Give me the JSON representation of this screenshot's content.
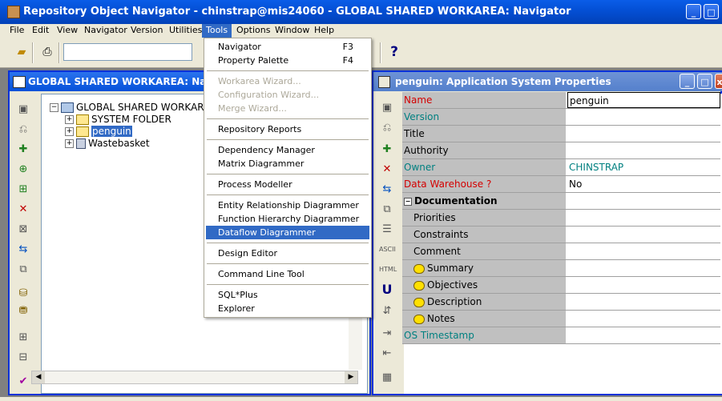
{
  "app": {
    "title": "Repository Object Navigator - chinstrap@mis24060 - GLOBAL SHARED WORKAREA: Navigator"
  },
  "menubar": [
    "File",
    "Edit",
    "View",
    "Navigator",
    "Version",
    "Utilities",
    "Tools",
    "Options",
    "Window",
    "Help"
  ],
  "active_menu": "Tools",
  "toolbar": {
    "help_icon": "?"
  },
  "navigator": {
    "title": "GLOBAL SHARED WORKAREA: Navig",
    "tree": [
      {
        "label": "GLOBAL SHARED WORKAR",
        "expander": "−"
      },
      {
        "label": "SYSTEM FOLDER",
        "expander": "+"
      },
      {
        "label": "penguin",
        "expander": "+"
      },
      {
        "label": "Wastebasket",
        "expander": "+"
      }
    ]
  },
  "tools_menu": {
    "items": [
      {
        "label": "Navigator",
        "shortcut": "F3",
        "state": "normal"
      },
      {
        "label": "Property Palette",
        "shortcut": "F4",
        "state": "normal"
      },
      {
        "label": "Workarea Wizard...",
        "shortcut": "",
        "state": "disabled"
      },
      {
        "label": "Configuration Wizard...",
        "shortcut": "",
        "state": "disabled"
      },
      {
        "label": "Merge Wizard...",
        "shortcut": "",
        "state": "disabled"
      },
      {
        "label": "Repository Reports",
        "shortcut": "",
        "state": "normal"
      },
      {
        "label": "Dependency Manager",
        "shortcut": "",
        "state": "normal"
      },
      {
        "label": "Matrix Diagrammer",
        "shortcut": "",
        "state": "normal"
      },
      {
        "label": "Process Modeller",
        "shortcut": "",
        "state": "normal"
      },
      {
        "label": "Entity Relationship Diagrammer",
        "shortcut": "",
        "state": "normal"
      },
      {
        "label": "Function Hierarchy Diagrammer",
        "shortcut": "",
        "state": "normal"
      },
      {
        "label": "Dataflow Diagrammer",
        "shortcut": "",
        "state": "selected"
      },
      {
        "label": "Design Editor",
        "shortcut": "",
        "state": "normal"
      },
      {
        "label": "Command Line Tool",
        "shortcut": "",
        "state": "normal"
      },
      {
        "label": "SQL*Plus",
        "shortcut": "",
        "state": "normal"
      },
      {
        "label": "Explorer",
        "shortcut": "",
        "state": "normal"
      }
    ]
  },
  "properties": {
    "title": "penguin: Application System Properties",
    "rows": [
      {
        "name": "Name",
        "value": "penguin",
        "name_color": "#d40000",
        "value_color": "#000000"
      },
      {
        "name": "Version",
        "value": "",
        "name_color": "#008080",
        "value_color": "#000000"
      },
      {
        "name": "Title",
        "value": "",
        "name_color": "#000000",
        "value_color": "#000000"
      },
      {
        "name": "Authority",
        "value": "",
        "name_color": "#000000",
        "value_color": "#000000"
      },
      {
        "name": "Owner",
        "value": "CHINSTRAP",
        "name_color": "#008080",
        "value_color": "#008080"
      },
      {
        "name": "Data Warehouse ?",
        "value": "No",
        "name_color": "#d40000",
        "value_color": "#000000"
      },
      {
        "name": "Documentation",
        "value": "",
        "name_color": "#000000",
        "value_color": "#000000",
        "group": true
      },
      {
        "name": "Priorities",
        "value": "",
        "name_color": "#000000",
        "value_color": "#000000",
        "child": true
      },
      {
        "name": "Constraints",
        "value": "",
        "name_color": "#000000",
        "value_color": "#000000",
        "child": true
      },
      {
        "name": "Comment",
        "value": "",
        "name_color": "#000000",
        "value_color": "#000000",
        "child": true
      },
      {
        "name": "Summary",
        "value": "",
        "name_color": "#000000",
        "value_color": "#000000",
        "child": true,
        "bubble": true
      },
      {
        "name": "Objectives",
        "value": "",
        "name_color": "#000000",
        "value_color": "#000000",
        "child": true,
        "bubble": true
      },
      {
        "name": "Description",
        "value": "",
        "name_color": "#000000",
        "value_color": "#000000",
        "child": true,
        "bubble": true
      },
      {
        "name": "Notes",
        "value": "",
        "name_color": "#000000",
        "value_color": "#000000",
        "child": true,
        "bubble": true
      },
      {
        "name": "OS Timestamp",
        "value": "",
        "name_color": "#008080",
        "value_color": "#000000"
      }
    ]
  },
  "colors": {
    "title_active": "#0551d9",
    "menu_highlight": "#316ac5",
    "required_red": "#d40000",
    "readonly_teal": "#008080"
  }
}
